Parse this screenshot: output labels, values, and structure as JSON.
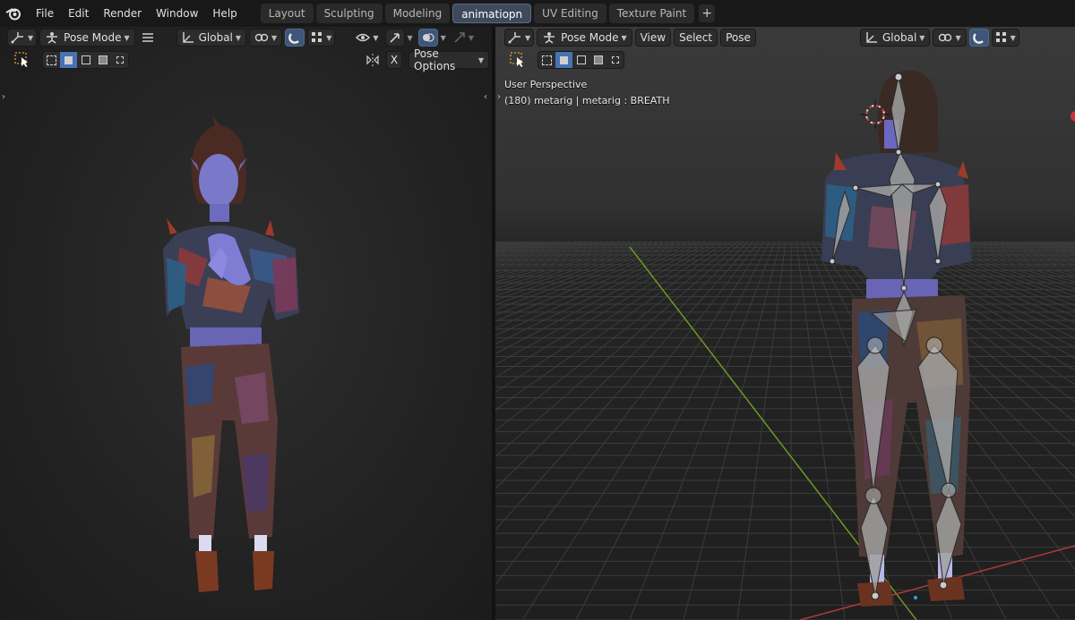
{
  "menubar": {
    "items": [
      "File",
      "Edit",
      "Render",
      "Window",
      "Help"
    ],
    "workspaces": [
      {
        "label": "Layout",
        "active": false
      },
      {
        "label": "Sculpting",
        "active": false
      },
      {
        "label": "Modeling",
        "active": false
      },
      {
        "label": "animatiopn",
        "active": true
      },
      {
        "label": "UV Editing",
        "active": false
      },
      {
        "label": "Texture Paint",
        "active": false
      }
    ],
    "add_symbol": "+"
  },
  "left_viewport": {
    "mode_label": "Pose Mode",
    "orientation_label": "Global",
    "x_label": "X",
    "pose_options_label": "Pose Options"
  },
  "right_viewport": {
    "mode_label": "Pose Mode",
    "menu": [
      "View",
      "Select",
      "Pose"
    ],
    "orientation_label": "Global",
    "perspective_label": "User Perspective",
    "object_info": "(180) metarig | metarig : BREATH"
  },
  "colors": {
    "accent": "#4772b3",
    "active_tab": "#3e4a5c",
    "grid_x_axis": "#b03a3a",
    "grid_y_axis": "#6a9a22"
  }
}
